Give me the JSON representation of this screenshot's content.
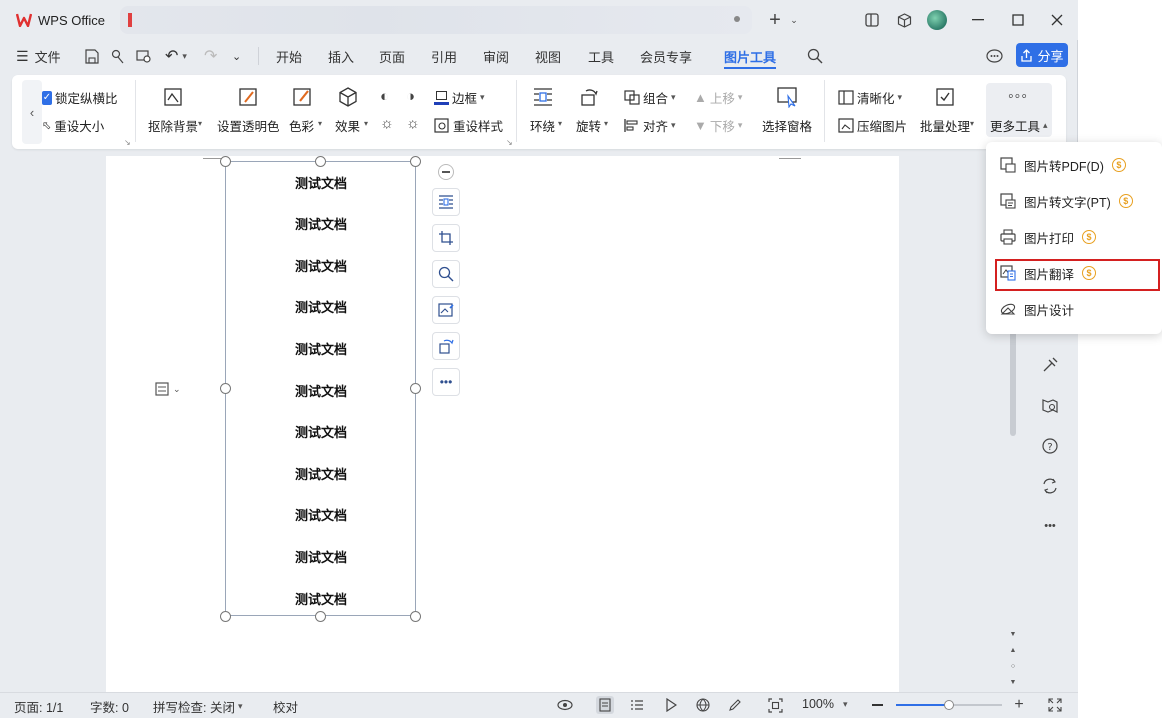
{
  "titlebar": {
    "app_name": "WPS Office"
  },
  "menubar": {
    "file": "文件",
    "items": [
      "开始",
      "插入",
      "页面",
      "引用",
      "审阅",
      "视图",
      "工具",
      "会员专享",
      "图片工具"
    ],
    "share": "分享"
  },
  "ribbon": {
    "lock_ratio": "锁定纵横比",
    "reset_size": "重设大小",
    "remove_bg": "抠除背景",
    "set_transparent": "设置透明色",
    "color": "色彩",
    "effect": "效果",
    "border": "边框",
    "reset_style": "重设样式",
    "wrap": "环绕",
    "rotate": "旋转",
    "group": "组合",
    "align": "对齐",
    "bring_up": "上移",
    "send_down": "下移",
    "select_pane": "选择窗格",
    "sharpen": "清晰化",
    "compress": "压缩图片",
    "batch": "批量处理",
    "more_tools": "更多工具"
  },
  "document": {
    "lines": [
      "测试文档",
      "测试文档",
      "测试文档",
      "测试文档",
      "测试文档",
      "测试文档",
      "测试文档",
      "测试文档",
      "测试文档",
      "测试文档",
      "测试文档"
    ]
  },
  "dropdown": {
    "items": [
      "图片转PDF(D)",
      "图片转文字(PT)",
      "图片打印",
      "图片翻译",
      "图片设计"
    ],
    "highlighted": "图片翻译"
  },
  "statusbar": {
    "page": "页面: 1/1",
    "words": "字数: 0",
    "spell": "拼写检查: 关闭",
    "proof": "校对",
    "zoom": "100%",
    "zoom_level": 0.5
  },
  "colors": {
    "accent": "#2f6fe6",
    "highlight_border": "#d42020",
    "badge": "#e8a020"
  }
}
